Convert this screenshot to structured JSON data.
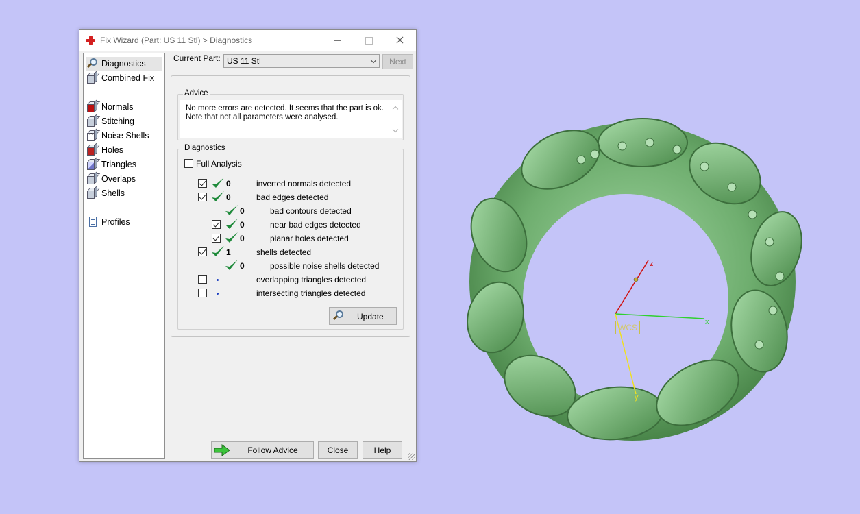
{
  "window": {
    "title": "Fix Wizard (Part: US 11 Stl) > Diagnostics"
  },
  "nav": {
    "items": [
      {
        "label": "Diagnostics",
        "icon": "magnifier-icon",
        "selected": true
      },
      {
        "label": "Combined Fix",
        "icon": "cube-icon"
      },
      {
        "label": "Normals",
        "icon": "normals-cube-icon"
      },
      {
        "label": "Stitching",
        "icon": "stitching-cube-icon"
      },
      {
        "label": "Noise Shells",
        "icon": "noise-shells-dice-icon"
      },
      {
        "label": "Holes",
        "icon": "holes-cube-icon"
      },
      {
        "label": "Triangles",
        "icon": "triangles-cube-icon"
      },
      {
        "label": "Overlaps",
        "icon": "overlaps-cube-icon"
      },
      {
        "label": "Shells",
        "icon": "shells-cube-icon"
      },
      {
        "label": "Profiles",
        "icon": "document-icon"
      }
    ]
  },
  "current_part": {
    "label": "Current Part:",
    "value": "US 11 Stl",
    "next_label": "Next"
  },
  "advice": {
    "title": "Advice",
    "text": "No more errors are detected. It seems that the part is ok. Note that not all parameters were analysed."
  },
  "diagnostics": {
    "title": "Diagnostics",
    "full_analysis_label": "Full Analysis",
    "full_analysis_checked": false,
    "rows": [
      {
        "checkbox": true,
        "checked": true,
        "status": "tick",
        "count": "0",
        "text": "inverted normals detected",
        "indent": 0
      },
      {
        "checkbox": true,
        "checked": true,
        "status": "tick",
        "count": "0",
        "text": "bad edges detected",
        "indent": 0
      },
      {
        "checkbox": false,
        "checked": false,
        "status": "tick",
        "count": "0",
        "text": "bad contours detected",
        "indent": 1
      },
      {
        "checkbox": true,
        "checked": true,
        "status": "tick",
        "count": "0",
        "text": "near bad edges detected",
        "indent": 1
      },
      {
        "checkbox": true,
        "checked": true,
        "status": "tick",
        "count": "0",
        "text": "planar holes detected",
        "indent": 1
      },
      {
        "checkbox": true,
        "checked": true,
        "status": "tick",
        "count": "1",
        "text": "shells detected",
        "indent": 0
      },
      {
        "checkbox": false,
        "checked": false,
        "status": "tick",
        "count": "0",
        "text": "possible noise shells detected",
        "indent": 1
      },
      {
        "checkbox": true,
        "checked": false,
        "status": "dot",
        "count": "",
        "text": "overlapping triangles detected",
        "indent": 0
      },
      {
        "checkbox": true,
        "checked": false,
        "status": "dot",
        "count": "",
        "text": "intersecting triangles detected",
        "indent": 0
      }
    ],
    "update_label": "Update"
  },
  "footer": {
    "follow_advice_label": "Follow Advice",
    "close_label": "Close",
    "help_label": "Help"
  },
  "viewport": {
    "axes": {
      "z": "z",
      "x": "x",
      "y": "y"
    },
    "wcs_label": "WCS",
    "colors": {
      "background": "#c4c4f8",
      "model": "#6fae6f",
      "z_axis": "#d01010",
      "x_axis": "#30d030",
      "y_axis": "#f0e020"
    }
  }
}
